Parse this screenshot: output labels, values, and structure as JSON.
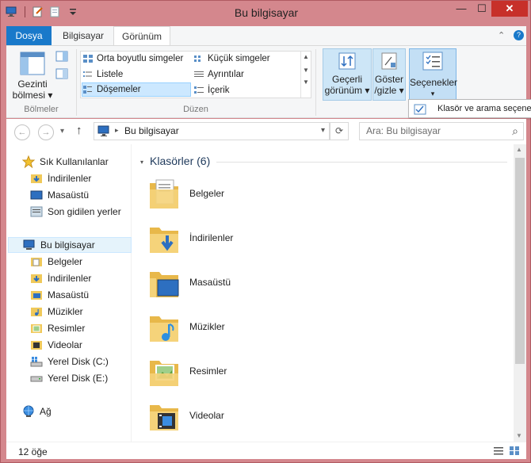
{
  "window": {
    "title": "Bu bilgisayar",
    "minimize_glyph": "—",
    "maximize_glyph": "☐",
    "close_glyph": "✕"
  },
  "ribbon_tabs": {
    "file": "Dosya",
    "computer": "Bilgisayar",
    "view": "Görünüm",
    "collapse_glyph": "⌃",
    "help_glyph": "?"
  },
  "ribbon": {
    "navigation_pane_label_1": "Gezinti",
    "navigation_pane_label_2": "bölmesi ▾",
    "panes_group_label": "Bölmeler",
    "layout_items": [
      "Orta boyutlu simgeler",
      "Küçük simgeler",
      "Listele",
      "Ayrıntılar",
      "Döşemeler",
      "İçerik"
    ],
    "layout_group_label": "Düzen",
    "current_view_1": "Geçerli",
    "current_view_2": "görünüm ▾",
    "show_hide_1": "Göster",
    "show_hide_2": "/gizle ▾",
    "options_label": "Seçenekler",
    "options_arrow": "▾",
    "tooltip": "Klasör ve arama seçenekleri"
  },
  "navigation": {
    "back_glyph": "←",
    "forward_glyph": "→",
    "up_glyph": "↑",
    "address_separator": "▸",
    "address_location": "Bu bilgisayar",
    "dropdown_glyph": "▾",
    "refresh_glyph": "⟳",
    "search_placeholder": "Ara: Bu bilgisayar",
    "search_glyph": "⌕"
  },
  "nav_pane": {
    "favorites_label": "Sık Kullanılanlar",
    "favorites": [
      "İndirilenler",
      "Masaüstü",
      "Son gidilen yerler"
    ],
    "this_pc_label": "Bu bilgisayar",
    "this_pc_items": [
      "Belgeler",
      "İndirilenler",
      "Masaüstü",
      "Müzikler",
      "Resimler",
      "Videolar",
      "Yerel Disk (C:)",
      "Yerel Disk (E:)"
    ],
    "network_label": "Ağ"
  },
  "main": {
    "group_header": "Klasörler (6)",
    "folders": [
      "Belgeler",
      "İndirilenler",
      "Masaüstü",
      "Müzikler",
      "Resimler",
      "Videolar"
    ]
  },
  "status": {
    "item_count": "12 öğe"
  },
  "colors": {
    "frame": "#d4878d",
    "file_tab": "#1979ca",
    "selection": "#cce8ff",
    "folder": "#f0c95a",
    "group_header": "#1e395b"
  }
}
